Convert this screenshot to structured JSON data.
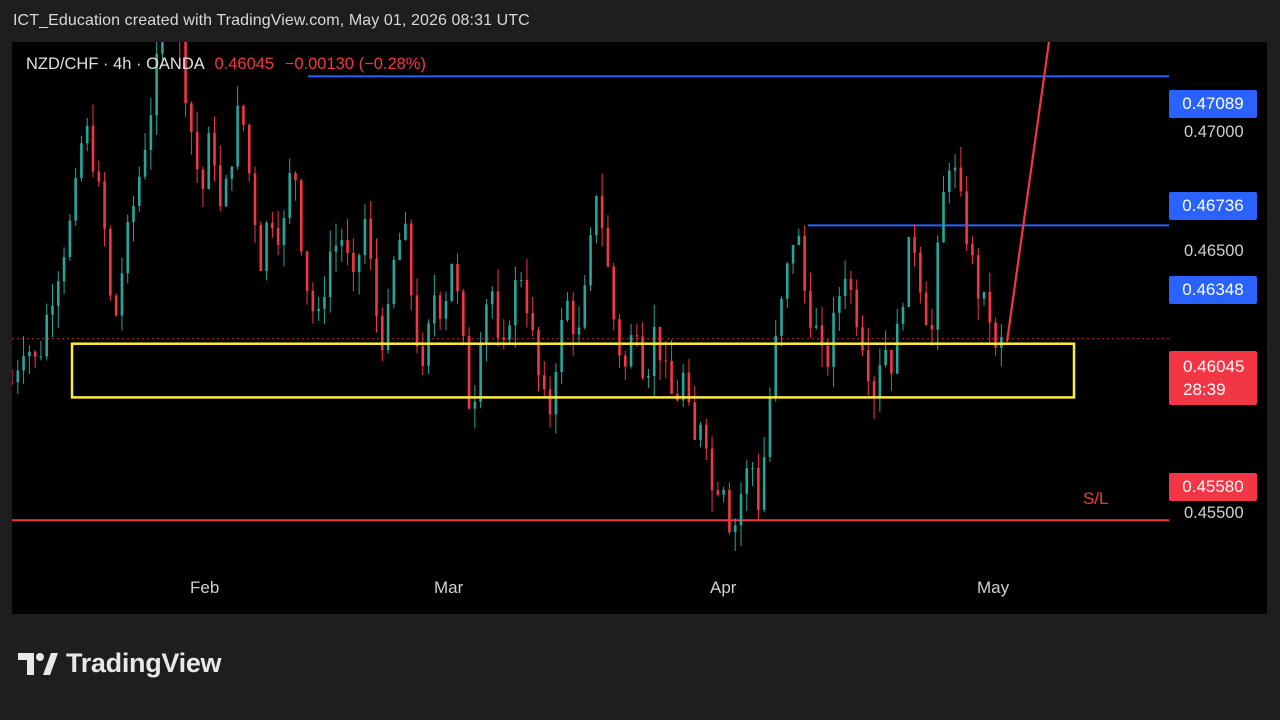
{
  "header": {
    "text": "ICT_Education created with TradingView.com, May 01, 2026 08:31 UTC"
  },
  "chart": {
    "symbol": "NZD/CHF · 4h · OANDA",
    "last_price": "0.46045",
    "change": "−0.00130 (−0.28%)",
    "countdown": "28:39",
    "sl_label": "S/L",
    "colors": {
      "up": "#26a69a",
      "down": "#f23645",
      "level_line": "#2962ff",
      "zone": "#ffeb3b",
      "stop_line": "#f23645",
      "background": "#000000"
    }
  },
  "price_axis": {
    "tags": {
      "t1": "0.47089",
      "t2": "0.46736",
      "t3": "0.46348",
      "t4": "0.45580"
    },
    "ticks": {
      "a": "0.47000",
      "b": "0.46500",
      "c": "0.45500"
    }
  },
  "time_axis": {
    "labels": [
      "Feb",
      "Mar",
      "Apr",
      "May"
    ]
  },
  "footer": {
    "brand": "TradingView"
  },
  "chart_data": {
    "type": "candlestick",
    "title": "NZD/CHF · 4h · OANDA",
    "x_ticks": [
      "Feb",
      "Mar",
      "Apr",
      "May"
    ],
    "y_ticks": [
      0.455,
      0.465,
      0.47
    ],
    "horizontal_levels": [
      {
        "price": 0.47089,
        "color": "#2962ff"
      },
      {
        "price": 0.46736,
        "color": "#2962ff"
      },
      {
        "price": 0.46348,
        "color": "#2962ff"
      },
      {
        "price": 0.4558,
        "color": "#f23645",
        "label": "S/L"
      }
    ],
    "zone": {
      "from": 0.459,
      "to": 0.46045,
      "color": "#ffeb3b"
    },
    "last_price": 0.46045,
    "close_path": [
      [
        0,
        0.4594
      ],
      [
        8,
        0.4605
      ],
      [
        16,
        0.4598
      ],
      [
        22,
        0.4612
      ],
      [
        30,
        0.4625
      ],
      [
        38,
        0.4638
      ],
      [
        45,
        0.4662
      ],
      [
        52,
        0.4649
      ],
      [
        58,
        0.4632
      ],
      [
        63,
        0.4606
      ],
      [
        70,
        0.4628
      ],
      [
        78,
        0.4645
      ],
      [
        86,
        0.4664
      ],
      [
        92,
        0.4682
      ],
      [
        98,
        0.4702
      ],
      [
        103,
        0.4686
      ],
      [
        110,
        0.4664
      ],
      [
        118,
        0.4642
      ],
      [
        124,
        0.4661
      ],
      [
        130,
        0.4637
      ],
      [
        136,
        0.4651
      ],
      [
        142,
        0.4668
      ],
      [
        148,
        0.4647
      ],
      [
        155,
        0.4625
      ],
      [
        160,
        0.4639
      ],
      [
        168,
        0.4631
      ],
      [
        175,
        0.4654
      ],
      [
        182,
        0.4622
      ],
      [
        190,
        0.4608
      ],
      [
        198,
        0.4628
      ],
      [
        206,
        0.4632
      ],
      [
        212,
        0.4618
      ],
      [
        220,
        0.4637
      ],
      [
        226,
        0.4613
      ],
      [
        232,
        0.4603
      ],
      [
        238,
        0.4626
      ],
      [
        244,
        0.4635
      ],
      [
        250,
        0.4611
      ],
      [
        256,
        0.4594
      ],
      [
        262,
        0.4618
      ],
      [
        268,
        0.4612
      ],
      [
        274,
        0.4627
      ],
      [
        280,
        0.4606
      ],
      [
        286,
        0.4583
      ],
      [
        292,
        0.4609
      ],
      [
        298,
        0.4621
      ],
      [
        304,
        0.4596
      ],
      [
        310,
        0.4613
      ],
      [
        316,
        0.4624
      ],
      [
        322,
        0.4611
      ],
      [
        328,
        0.4594
      ],
      [
        334,
        0.4584
      ],
      [
        340,
        0.4605
      ],
      [
        346,
        0.4615
      ],
      [
        352,
        0.4604
      ],
      [
        358,
        0.4621
      ],
      [
        364,
        0.4646
      ],
      [
        370,
        0.4626
      ],
      [
        376,
        0.4605
      ],
      [
        382,
        0.4597
      ],
      [
        388,
        0.4612
      ],
      [
        394,
        0.4594
      ],
      [
        400,
        0.4608
      ],
      [
        406,
        0.4597
      ],
      [
        412,
        0.4588
      ],
      [
        418,
        0.4596
      ],
      [
        424,
        0.4576
      ],
      [
        430,
        0.4588
      ],
      [
        436,
        0.4564
      ],
      [
        442,
        0.4571
      ],
      [
        448,
        0.4553
      ],
      [
        454,
        0.4566
      ],
      [
        460,
        0.4574
      ],
      [
        465,
        0.4561
      ],
      [
        470,
        0.4584
      ],
      [
        476,
        0.4607
      ],
      [
        482,
        0.4622
      ],
      [
        488,
        0.4636
      ],
      [
        494,
        0.4615
      ],
      [
        500,
        0.4608
      ],
      [
        506,
        0.4596
      ],
      [
        512,
        0.4611
      ],
      [
        518,
        0.4624
      ],
      [
        524,
        0.4614
      ],
      [
        530,
        0.4604
      ],
      [
        536,
        0.4591
      ],
      [
        542,
        0.4605
      ],
      [
        548,
        0.4598
      ],
      [
        554,
        0.4616
      ],
      [
        560,
        0.4634
      ],
      [
        566,
        0.4618
      ],
      [
        572,
        0.4605
      ],
      [
        578,
        0.4638
      ],
      [
        584,
        0.4654
      ],
      [
        590,
        0.4641
      ],
      [
        596,
        0.4628
      ],
      [
        602,
        0.4616
      ],
      [
        608,
        0.4612
      ],
      [
        612,
        0.4601
      ],
      [
        616,
        0.46045
      ]
    ],
    "forecast_arrow": {
      "from": 0.46045,
      "to": 0.47089
    }
  }
}
